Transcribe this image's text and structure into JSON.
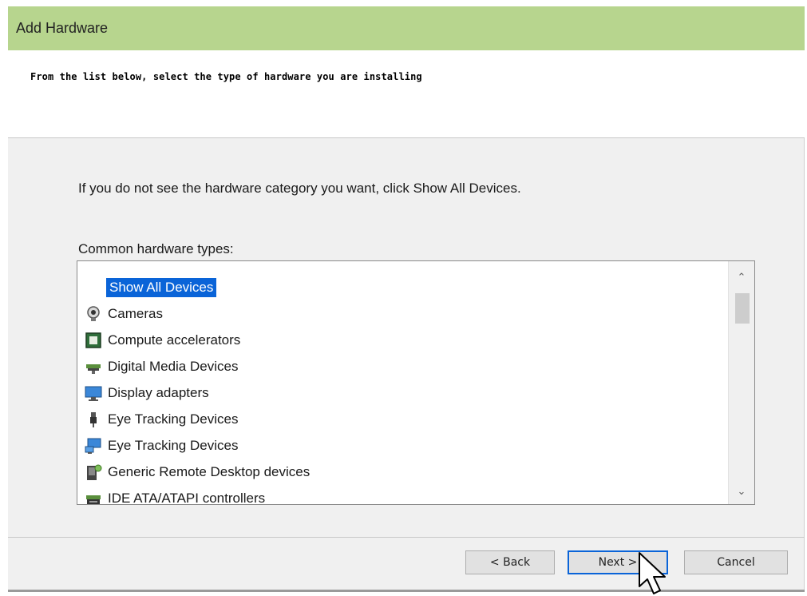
{
  "window": {
    "title": "Add Hardware"
  },
  "header": {
    "heading": "From the list below, select the type of hardware you are installing"
  },
  "main": {
    "instruction": "If you do not see the hardware category you want, click Show All Devices.",
    "list_label": "Common hardware types:",
    "items": [
      {
        "label": "Show All Devices",
        "icon": "none",
        "selected": true
      },
      {
        "label": "Cameras",
        "icon": "camera-icon",
        "selected": false
      },
      {
        "label": "Compute accelerators",
        "icon": "chip-icon",
        "selected": false
      },
      {
        "label": "Digital Media Devices",
        "icon": "media-device-icon",
        "selected": false
      },
      {
        "label": "Display adapters",
        "icon": "monitor-icon",
        "selected": false
      },
      {
        "label": "Eye Tracking Devices",
        "icon": "usb-plug-icon",
        "selected": false
      },
      {
        "label": "Eye Tracking Devices",
        "icon": "network-computer-icon",
        "selected": false
      },
      {
        "label": "Generic Remote Desktop devices",
        "icon": "remote-desktop-icon",
        "selected": false
      },
      {
        "label": "IDE ATA/ATAPI controllers",
        "icon": "disk-controller-icon",
        "selected": false
      }
    ]
  },
  "footer": {
    "back_label": "< Back",
    "next_label": "Next >",
    "cancel_label": "Cancel"
  },
  "colors": {
    "titlebar": "#b7d58e",
    "selection": "#0a64d8",
    "default_button_border": "#0a64d8"
  }
}
